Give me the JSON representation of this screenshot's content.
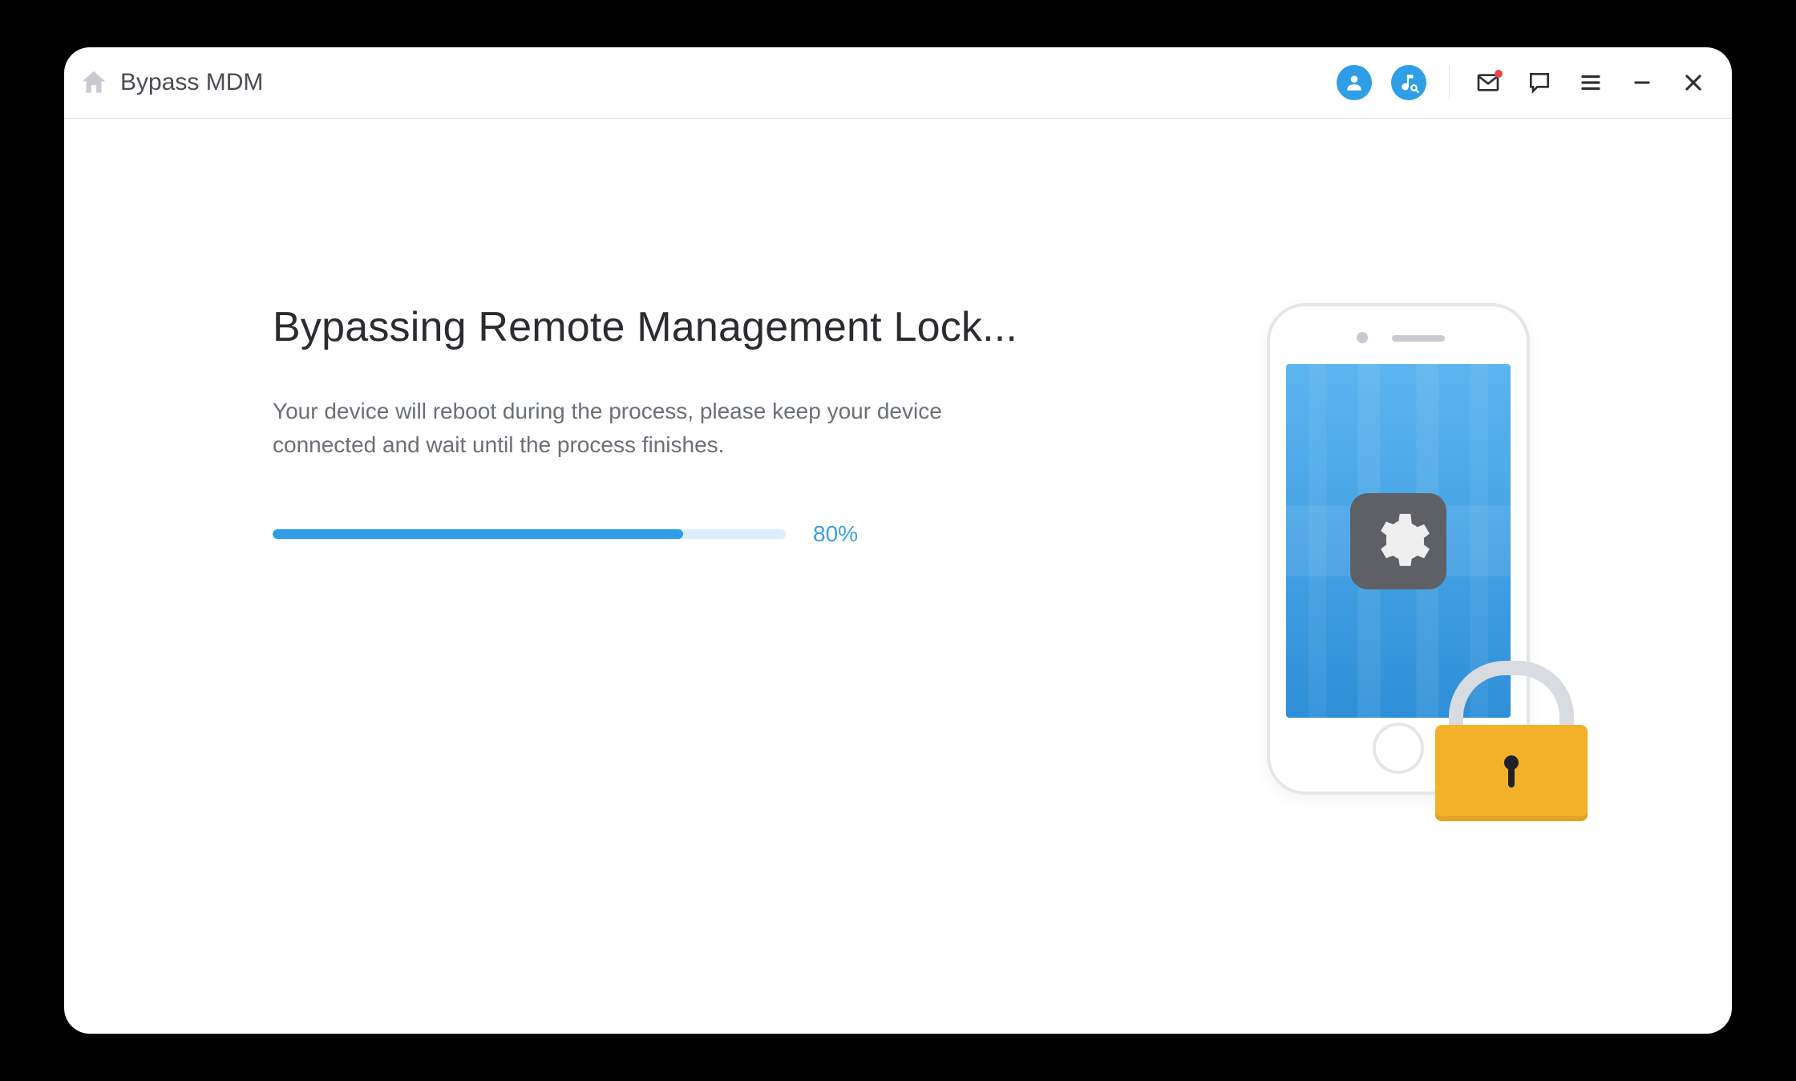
{
  "titlebar": {
    "app_title": "Bypass MDM"
  },
  "main": {
    "heading": "Bypassing Remote Management Lock...",
    "subtext": "Your device will reboot during the process, please keep your device connected and wait until the process finishes.",
    "progress_percent": 80,
    "progress_label": "80%"
  },
  "icons": {
    "home": "home-icon",
    "account": "account-icon",
    "music": "music-search-icon",
    "mail": "mail-icon",
    "feedback": "speech-bubble-icon",
    "menu": "hamburger-menu-icon",
    "minimize": "minimize-icon",
    "close": "close-icon",
    "gear": "gear-icon",
    "lock": "lock-icon"
  },
  "colors": {
    "accent": "#2f9ee6",
    "track": "#dceefc",
    "lock_body": "#f3b12a"
  }
}
